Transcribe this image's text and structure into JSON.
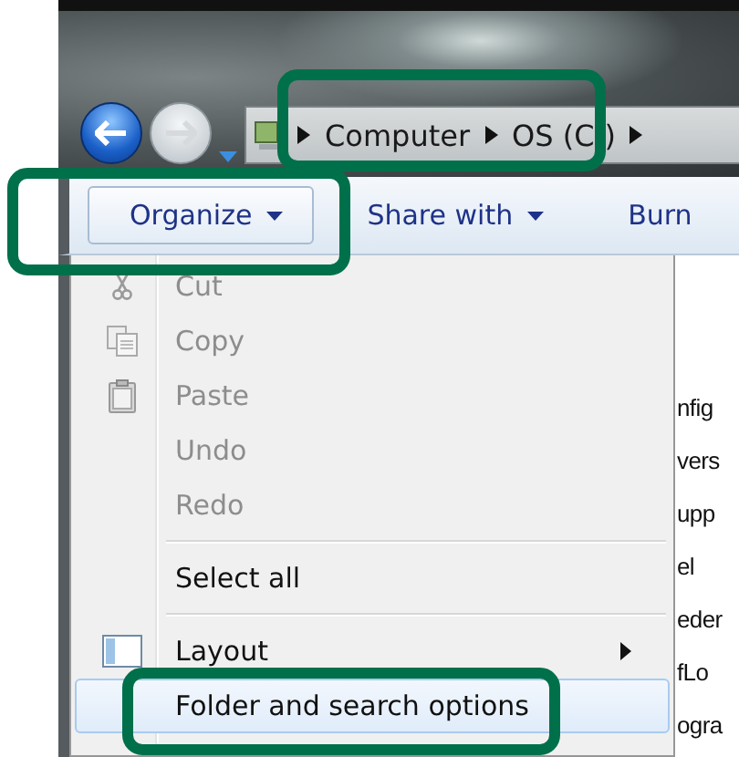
{
  "navigation": {
    "back": {
      "disabled": false
    },
    "forward": {
      "disabled": true
    }
  },
  "address_bar": {
    "crumbs": [
      "Computer",
      "OS (C:)"
    ]
  },
  "toolbar": [
    {
      "label": "Organize",
      "dropdown": true,
      "selected": true
    },
    {
      "label": "Share with",
      "dropdown": true,
      "selected": false
    },
    {
      "label": "Burn",
      "dropdown": false,
      "selected": false
    }
  ],
  "menu": [
    {
      "kind": "item",
      "label": "Cut",
      "disabled": true,
      "selected": false,
      "submenu": false
    },
    {
      "kind": "item",
      "label": "Copy",
      "disabled": true,
      "selected": false,
      "submenu": false
    },
    {
      "kind": "item",
      "label": "Paste",
      "disabled": true,
      "selected": false,
      "submenu": false
    },
    {
      "kind": "item",
      "label": "Undo",
      "disabled": true,
      "selected": false,
      "submenu": false
    },
    {
      "kind": "item",
      "label": "Redo",
      "disabled": true,
      "selected": false,
      "submenu": false
    },
    {
      "kind": "separator"
    },
    {
      "kind": "item",
      "label": "Select all",
      "disabled": false,
      "selected": false,
      "submenu": false
    },
    {
      "kind": "separator"
    },
    {
      "kind": "item",
      "label": "Layout",
      "disabled": false,
      "selected": false,
      "submenu": true
    },
    {
      "kind": "item",
      "label": "Folder and search options",
      "disabled": false,
      "selected": true,
      "submenu": false
    }
  ],
  "file_list": [
    "nfig",
    "vers",
    "upp",
    "el",
    "eder",
    "fLo",
    "ogra"
  ],
  "highlights": [
    {
      "kind": "frame"
    },
    {
      "kind": "frame"
    },
    {
      "kind": "frame"
    }
  ]
}
